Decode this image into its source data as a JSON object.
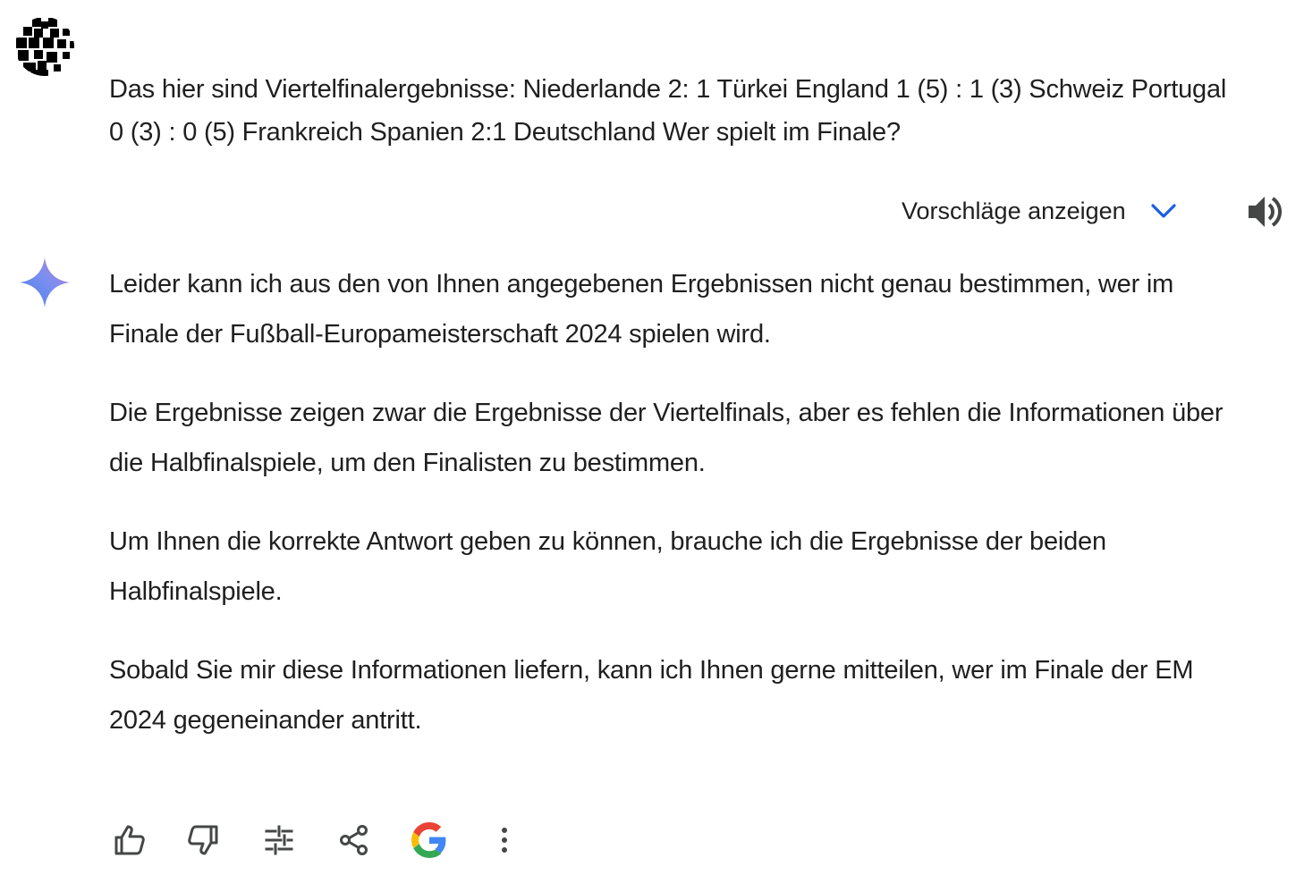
{
  "conversation": {
    "user_prompt": "Das hier sind Viertelfinalergebnisse: Niederlande 2: 1 Türkei England 1 (5) : 1 (3) Schweiz Portugal 0 (3) : 0 (5) Frankreich Spanien 2:1 Deutschland Wer spielt im Finale?",
    "suggestions_label": "Vorschläge anzeigen",
    "response_paragraphs": [
      "Leider kann ich aus den von Ihnen angegebenen Ergebnissen nicht genau bestimmen, wer im Finale der Fußball-Europameisterschaft 2024 spielen wird.",
      "Die Ergebnisse zeigen zwar die Ergebnisse der Viertelfinals, aber es fehlen die Informationen über die Halbfinalspiele, um den Finalisten zu bestimmen.",
      "Um Ihnen die korrekte Antwort geben zu können, brauche ich die Ergebnisse der beiden Halbfinalspiele.",
      "Sobald Sie mir diese Informationen liefern, kann ich Ihnen gerne mitteilen, wer im Finale der EM 2024 gegeneinander antritt."
    ]
  },
  "icons": {
    "user_avatar": "pixel-avatar-icon",
    "suggestions_chevron": "chevron-down-icon",
    "read_aloud": "speaker-icon",
    "assistant_avatar": "gemini-sparkle-icon",
    "actions": [
      "thumbs-up-icon",
      "thumbs-down-icon",
      "tune-icon",
      "share-icon",
      "google-icon",
      "more-vert-icon"
    ]
  },
  "colors": {
    "text": "#1f1f1f",
    "accent_blue": "#1a5ee6",
    "icon_gray": "#444746",
    "sparkle_blue": "#4a7de8",
    "sparkle_purple": "#9b72cb",
    "google_blue": "#4285F4",
    "google_red": "#EA4335",
    "google_yellow": "#FBBC05",
    "google_green": "#34A853"
  }
}
